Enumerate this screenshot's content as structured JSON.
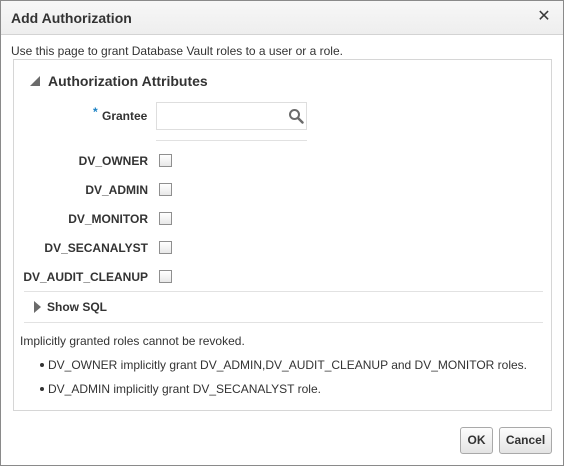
{
  "dialog": {
    "title": "Add Authorization",
    "close_icon": "close-icon",
    "description": "Use this page to grant Database Vault roles to a user or a role."
  },
  "section": {
    "title": "Authorization Attributes",
    "expanded": true,
    "arrow_icon": "triangle-expanded-icon"
  },
  "grantee": {
    "required_marker": "*",
    "label": "Grantee",
    "value": "",
    "search_icon": "search-icon"
  },
  "roles": [
    {
      "label": "DV_OWNER",
      "checked": false
    },
    {
      "label": "DV_ADMIN",
      "checked": false
    },
    {
      "label": "DV_MONITOR",
      "checked": false
    },
    {
      "label": "DV_SECANALYST",
      "checked": false
    },
    {
      "label": "DV_AUDIT_CLEANUP",
      "checked": false
    }
  ],
  "show_sql": {
    "label": "Show SQL",
    "expanded": false,
    "arrow_icon": "triangle-collapsed-icon"
  },
  "notes": {
    "intro": "Implicitly granted roles cannot be revoked.",
    "bullets": [
      "DV_OWNER implicitly grant DV_ADMIN,DV_AUDIT_CLEANUP and DV_MONITOR roles.",
      "DV_ADMIN implicitly grant DV_SECANALYST role."
    ]
  },
  "buttons": {
    "ok": "OK",
    "cancel": "Cancel"
  }
}
